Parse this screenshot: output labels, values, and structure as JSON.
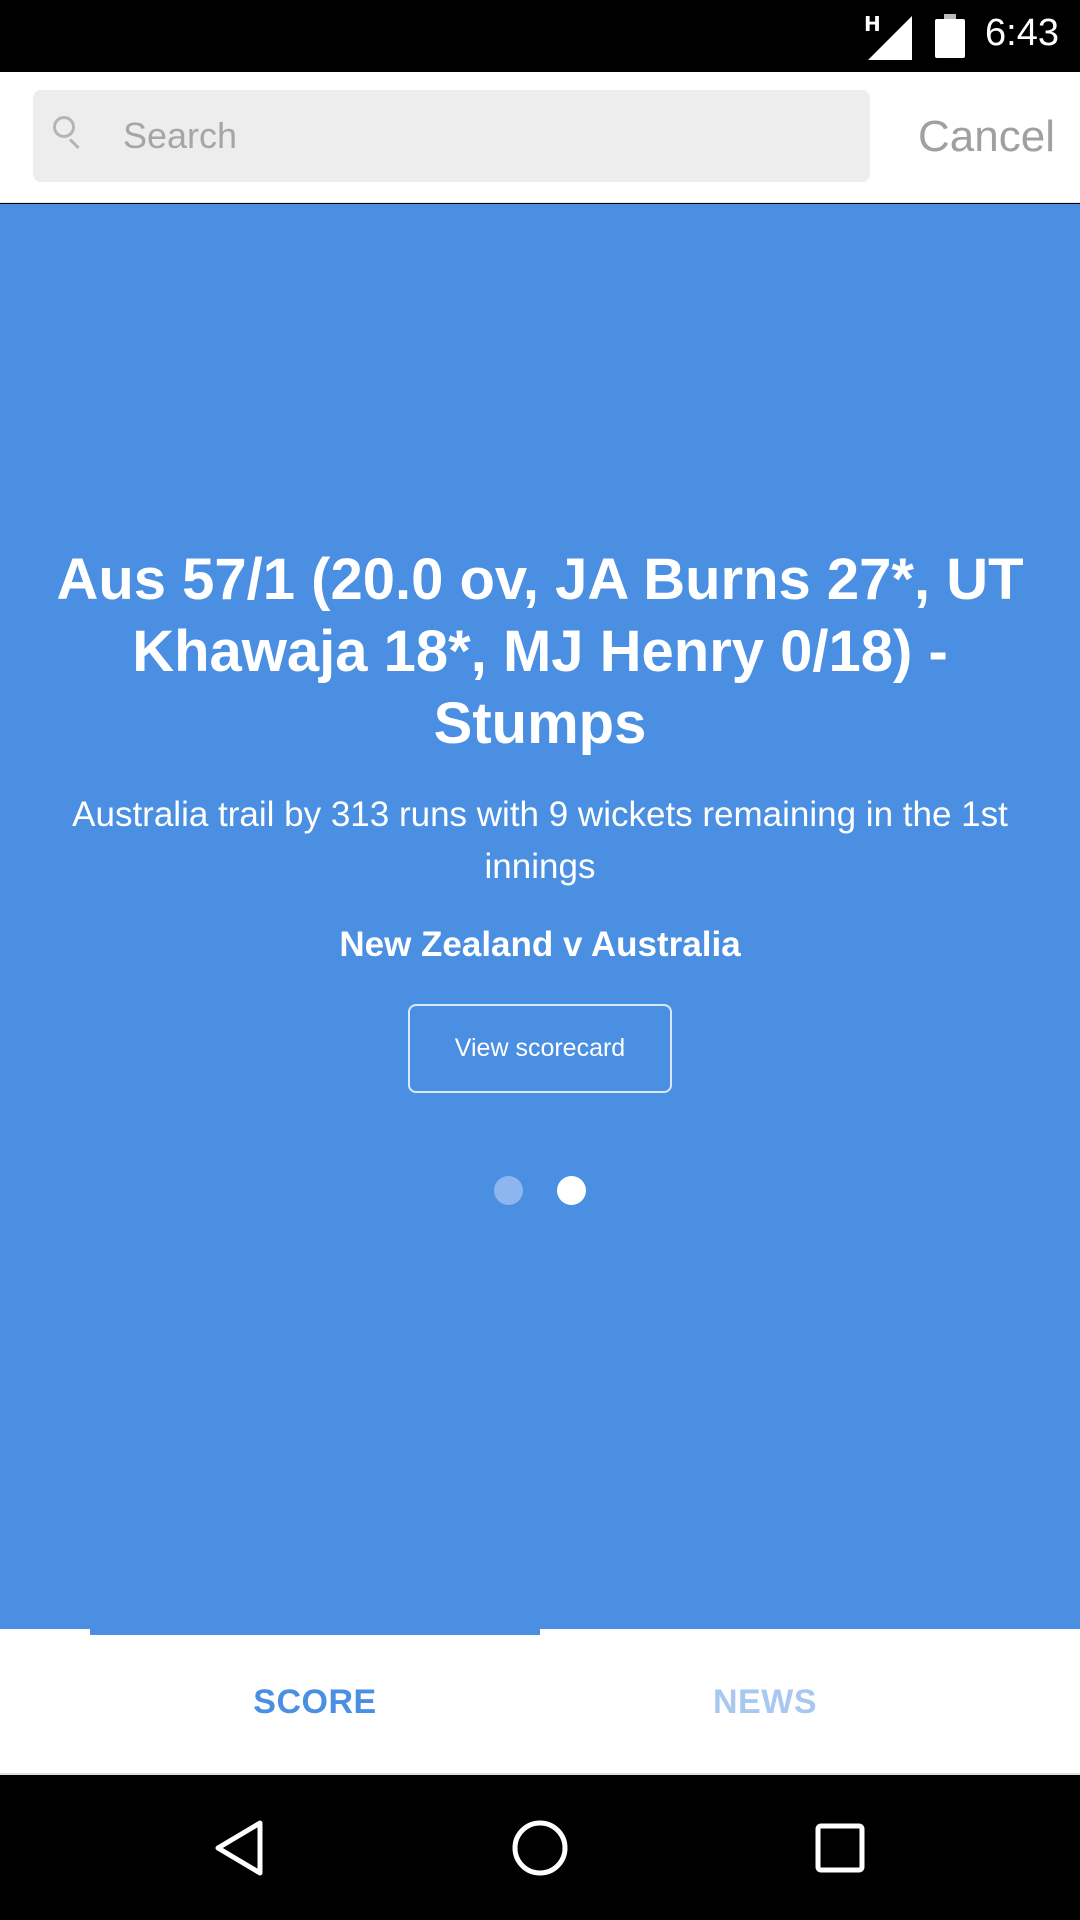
{
  "status_bar": {
    "network_label": "H",
    "time": "6:43",
    "icons": [
      "signal-icon",
      "battery-icon"
    ]
  },
  "search": {
    "placeholder": "Search",
    "value": "",
    "cancel_label": "Cancel"
  },
  "score_card": {
    "headline": "Aus 57/1 (20.0 ov, JA Burns 27*, UT Khawaja 18*, MJ Henry 0/18) - Stumps",
    "status_text": "Australia trail by 313 runs with 9 wickets remaining in the 1st innings",
    "match_title": "New Zealand v Australia",
    "scorecard_button": "View scorecard"
  },
  "pager": {
    "page_count": 2,
    "active_page": 2
  },
  "tabs": [
    {
      "label": "SCORE",
      "selected": true
    },
    {
      "label": "NEWS",
      "selected": false
    }
  ],
  "nav_bar": {
    "buttons": [
      "back-icon",
      "home-icon",
      "recents-icon"
    ]
  },
  "colors": {
    "accent": "#4a8fe2",
    "tab_inactive": "#a9c8f1",
    "dot_inactive": "#8db6ee"
  }
}
